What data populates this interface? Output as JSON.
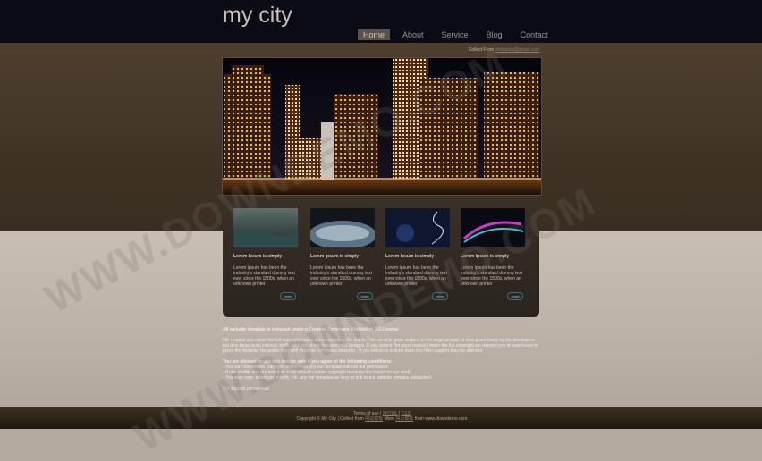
{
  "site": {
    "title": "my city",
    "nav": [
      "Home",
      "About",
      "Service",
      "Blog",
      "Contact"
    ],
    "collect_prefix": "Collect From",
    "collect_link": "mobanchi@gmail.com"
  },
  "cards": [
    {
      "title": "Lorem Ipsum is simply",
      "body": "Lorem Ipsum has been the industry's standard dummy text ever since the 1500s, when an unknown printer",
      "more": "more"
    },
    {
      "title": "Lorem Ipsum is simply",
      "body": "Lorem Ipsum has been the industry's standard dummy text ever since the 1500s, when an unknown printer",
      "more": "more"
    },
    {
      "title": "Lorem Ipsum is simply",
      "body": "Lorem Ipsum has been the industry's standard dummy text ever since the 1500s, when an unknown printer",
      "more": "more"
    },
    {
      "title": "Lorem Ipsum is simply",
      "body": "Lorem Ipsum has been the industry's standard dummy text ever since the 1500s, when an unknown printer",
      "more": "more"
    }
  ],
  "licence": {
    "heading": "All website template is released under a Creative Commons Attribution 2.5 License",
    "para": "We request you retain the full copyright notice below including the link to This not only gives respect to the large amount of time given freely by the developers but also helps build interest, traffic and use of our free and paid designs. If you cannot (for good reason) retain the full copyright we request you at least leave in place the Website Templates line, with Website Templates linked to . If you refuse to include even this then support may be affected.",
    "allowed_heading": "You are allowed to use this design only if you agree to the following conditions:",
    "conditions": [
      "- You can not remove copyright notice from any our template without our permission.",
      "- If you modify any our template it still should contain copyright because it is based on our work.",
      "- You may copy, distribute, modify, etc. any our template as long as link to our website remains untouched."
    ],
    "support": "For support please visit"
  },
  "footer": {
    "line1_prefix": "Terms of use",
    "line1_links": [
      "XHTML",
      "CSS"
    ],
    "line2_prefix": "Copyright © My City | Collect from",
    "line2_link1": "网站模板",
    "line2_mid": "More",
    "line2_link2": "网页模板",
    "line2_suffix": "from www.downdemo.com"
  },
  "watermark": "WWW.DOWNDEMO.COM"
}
